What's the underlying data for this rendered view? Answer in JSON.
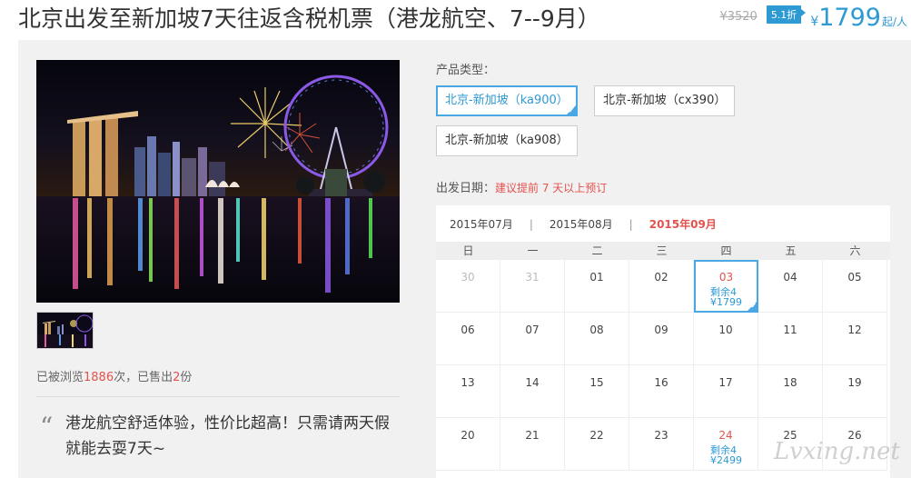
{
  "product": {
    "title": "北京出发至新加坡7天往返含税机票（港龙航空、7--9月）",
    "old_price": "¥3520",
    "discount": "5.1折",
    "currency": "¥",
    "price": "1799",
    "per_unit": "起/人"
  },
  "gallery": {
    "main_image": "singapore-night-skyline-fireworks",
    "thumbnail": "singapore-night-skyline-fireworks-thumb"
  },
  "stats": {
    "prefix": "已被浏览",
    "views": "1886",
    "middle": "次，已售出",
    "sold": "2",
    "suffix": "份"
  },
  "quote": {
    "mark": "“",
    "text": "港龙航空舒适体验，性价比超高！只需请两天假就能去耍7天~"
  },
  "product_type": {
    "label": "产品类型：",
    "options": [
      {
        "label": "北京-新加坡（ka900）",
        "selected": true
      },
      {
        "label": "北京-新加坡（cx390）",
        "selected": false
      },
      {
        "label": "北京-新加坡（ka908）",
        "selected": false
      }
    ]
  },
  "departure": {
    "label": "出发日期：",
    "hint": "建议提前 7 天以上预订"
  },
  "calendar": {
    "months": [
      {
        "label": "2015年07月",
        "active": false
      },
      {
        "label": "2015年08月",
        "active": false
      },
      {
        "label": "2015年09月",
        "active": true
      }
    ],
    "separator": "|",
    "weekdays": [
      "日",
      "一",
      "二",
      "三",
      "四",
      "五",
      "六"
    ],
    "weeks": [
      [
        {
          "day": "30",
          "other": true
        },
        {
          "day": "31",
          "other": true
        },
        {
          "day": "01"
        },
        {
          "day": "02"
        },
        {
          "day": "03",
          "available": true,
          "selected": true,
          "remaining": "剩余4",
          "price": "¥1799"
        },
        {
          "day": "04"
        },
        {
          "day": "05"
        }
      ],
      [
        {
          "day": "06"
        },
        {
          "day": "07"
        },
        {
          "day": "08"
        },
        {
          "day": "09"
        },
        {
          "day": "10"
        },
        {
          "day": "11"
        },
        {
          "day": "12"
        }
      ],
      [
        {
          "day": "13"
        },
        {
          "day": "14"
        },
        {
          "day": "15"
        },
        {
          "day": "16"
        },
        {
          "day": "17"
        },
        {
          "day": "18"
        },
        {
          "day": "19"
        }
      ],
      [
        {
          "day": "20"
        },
        {
          "day": "21"
        },
        {
          "day": "22"
        },
        {
          "day": "23"
        },
        {
          "day": "24",
          "available": true,
          "remaining": "剩余4",
          "price": "¥2499"
        },
        {
          "day": "25"
        },
        {
          "day": "26"
        }
      ]
    ]
  },
  "watermark": "Lvxing.net",
  "colors": {
    "accent_blue": "#2e9ad3",
    "accent_red": "#e4524e",
    "panel_bg": "#f1f1f1"
  }
}
